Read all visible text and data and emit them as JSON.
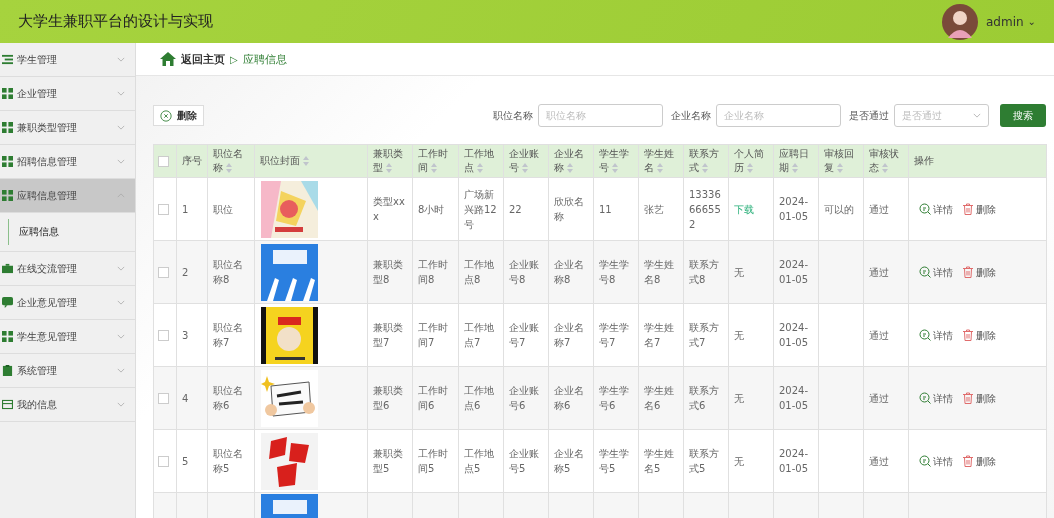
{
  "header": {
    "title": "大学生兼职平台的设计与实现",
    "user": "admin",
    "caret": "⌄"
  },
  "sidebar": {
    "items": [
      {
        "label": "学生管理",
        "kind": "list",
        "expanded": false
      },
      {
        "label": "企业管理",
        "kind": "grid",
        "expanded": false
      },
      {
        "label": "兼职类型管理",
        "kind": "grid",
        "expanded": false
      },
      {
        "label": "招聘信息管理",
        "kind": "grid",
        "expanded": false
      },
      {
        "label": "应聘信息管理",
        "kind": "grid",
        "expanded": true,
        "children": [
          {
            "label": "应聘信息",
            "selected": true
          }
        ]
      },
      {
        "label": "在线交流管理",
        "kind": "briefcase",
        "expanded": false
      },
      {
        "label": "企业意见管理",
        "kind": "chat",
        "expanded": false
      },
      {
        "label": "学生意见管理",
        "kind": "grid",
        "expanded": false
      },
      {
        "label": "系统管理",
        "kind": "clipboard",
        "expanded": false
      },
      {
        "label": "我的信息",
        "kind": "card",
        "expanded": false
      }
    ]
  },
  "breadcrumb": {
    "home": "返回主页",
    "separator": "▷",
    "current": "应聘信息"
  },
  "toolbar": {
    "delete_button": "删除",
    "filters": [
      {
        "label": "职位名称",
        "placeholder": "职位名称",
        "kind": "text"
      },
      {
        "label": "企业名称",
        "placeholder": "企业名称",
        "kind": "text"
      },
      {
        "label": "是否通过",
        "placeholder": "是否通过",
        "kind": "select"
      }
    ],
    "search_button": "搜索"
  },
  "table": {
    "select_all": {
      "checked": false
    },
    "columns": [
      {
        "label": "序号",
        "sortable": false
      },
      {
        "label": "职位名称",
        "sortable": true
      },
      {
        "label": "职位封面",
        "sortable": true
      },
      {
        "label": "兼职类型",
        "sortable": true
      },
      {
        "label": "工作时间",
        "sortable": true
      },
      {
        "label": "工作地点",
        "sortable": true
      },
      {
        "label": "企业账号",
        "sortable": true
      },
      {
        "label": "企业名称",
        "sortable": true
      },
      {
        "label": "学生学号",
        "sortable": true
      },
      {
        "label": "学生姓名",
        "sortable": true
      },
      {
        "label": "联系方式",
        "sortable": true
      },
      {
        "label": "个人简历",
        "sortable": true
      },
      {
        "label": "应聘日期",
        "sortable": true
      },
      {
        "label": "审核回复",
        "sortable": true
      },
      {
        "label": "审核状态",
        "sortable": true
      },
      {
        "label": "操作",
        "sortable": false
      }
    ],
    "rows": [
      {
        "checked": false,
        "no": "1",
        "name": "职位",
        "type": "类型xxx",
        "time": "8小时",
        "place": "广场新兴路12号",
        "company_account": "22",
        "company_name": "欣欣名称",
        "student_no": "11",
        "student_name": "张艺",
        "contact": "13336666552",
        "resume": "下载",
        "resume_link": true,
        "date": "2024-01-05",
        "reply": "可以的",
        "status": "通过",
        "actions": [
          "详情",
          "删除"
        ]
      },
      {
        "checked": false,
        "no": "2",
        "name": "职位名称8",
        "type": "兼职类型8",
        "time": "工作时间8",
        "place": "工作地点8",
        "company_account": "企业账号8",
        "company_name": "企业名称8",
        "student_no": "学生学号8",
        "student_name": "学生姓名8",
        "contact": "联系方式8",
        "resume": "无",
        "resume_link": false,
        "date": "2024-01-05",
        "status": "通过",
        "actions": [
          "详情",
          "删除"
        ]
      },
      {
        "checked": false,
        "no": "3",
        "name": "职位名称7",
        "type": "兼职类型7",
        "time": "工作时间7",
        "place": "工作地点7",
        "company_account": "企业账号7",
        "company_name": "企业名称7",
        "student_no": "学生学号7",
        "student_name": "学生姓名7",
        "contact": "联系方式7",
        "resume": "无",
        "resume_link": false,
        "date": "2024-01-05",
        "status": "通过",
        "actions": [
          "详情",
          "删除"
        ]
      },
      {
        "checked": false,
        "no": "4",
        "name": "职位名称6",
        "type": "兼职类型6",
        "time": "工作时间6",
        "place": "工作地点6",
        "company_account": "企业账号6",
        "company_name": "企业名称6",
        "student_no": "学生学号6",
        "student_name": "学生姓名6",
        "contact": "联系方式6",
        "resume": "无",
        "resume_link": false,
        "date": "2024-01-05",
        "status": "通过",
        "actions": [
          "详情",
          "删除"
        ]
      },
      {
        "checked": false,
        "no": "5",
        "name": "职位名称5",
        "type": "兼职类型5",
        "time": "工作时间5",
        "place": "工作地点5",
        "company_account": "企业账号5",
        "company_name": "企业名称5",
        "student_no": "学生学号5",
        "student_name": "学生姓名5",
        "contact": "联系方式5",
        "resume": "无",
        "resume_link": false,
        "date": "2024-01-05",
        "status": "通过",
        "actions": [
          "详情",
          "删除"
        ]
      }
    ]
  }
}
